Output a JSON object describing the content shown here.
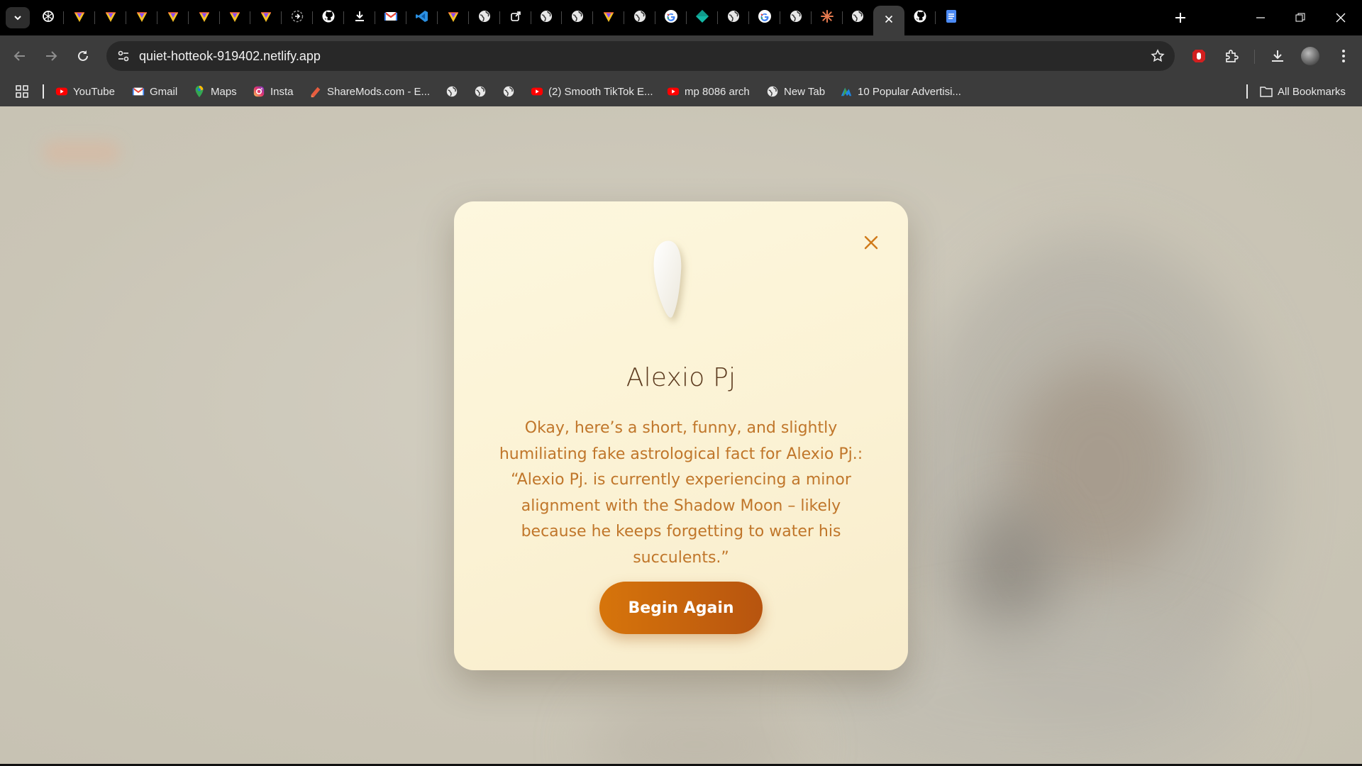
{
  "browser": {
    "address_bar": {
      "url": "quiet-hotteok-919402.netlify.app"
    },
    "tabs": [
      {
        "icon": "chatgpt-icon"
      },
      {
        "icon": "gemini-icon"
      },
      {
        "icon": "gemini-icon"
      },
      {
        "icon": "gemini-icon"
      },
      {
        "icon": "gemini-icon"
      },
      {
        "icon": "gemini-icon"
      },
      {
        "icon": "gemini-icon"
      },
      {
        "icon": "gemini-icon"
      },
      {
        "icon": "circle-arrow-icon"
      },
      {
        "icon": "github-icon"
      },
      {
        "icon": "download-icon"
      },
      {
        "icon": "gmail-icon"
      },
      {
        "icon": "vscode-icon"
      },
      {
        "icon": "gemini-icon"
      },
      {
        "icon": "globe-icon"
      },
      {
        "icon": "share-icon"
      },
      {
        "icon": "globe-icon"
      },
      {
        "icon": "globe-icon"
      },
      {
        "icon": "gemini-icon"
      },
      {
        "icon": "globe-icon"
      },
      {
        "icon": "google-icon"
      },
      {
        "icon": "diamond-icon"
      },
      {
        "icon": "globe-icon"
      },
      {
        "icon": "google-icon"
      },
      {
        "icon": "globe-icon"
      },
      {
        "icon": "claude-icon"
      },
      {
        "icon": "globe-icon"
      },
      {
        "icon": "close-icon",
        "active": true
      },
      {
        "icon": "github-icon"
      },
      {
        "icon": "docs-icon"
      }
    ],
    "bookmarks": [
      {
        "label": "YouTube",
        "icon": "youtube-icon"
      },
      {
        "label": "Gmail",
        "icon": "gmail-icon"
      },
      {
        "label": "Maps",
        "icon": "maps-icon"
      },
      {
        "label": "Insta",
        "icon": "instagram-icon"
      },
      {
        "label": "ShareMods.com - E...",
        "icon": "sharemods-icon"
      },
      {
        "label": "",
        "icon": "globe-icon"
      },
      {
        "label": "",
        "icon": "globe-icon"
      },
      {
        "label": "",
        "icon": "globe-icon"
      },
      {
        "label": "(2) Smooth TikTok E...",
        "icon": "youtube-icon"
      },
      {
        "label": "mp 8086 arch",
        "icon": "youtube-icon"
      },
      {
        "label": "New Tab",
        "icon": "globe-icon"
      },
      {
        "label": "10 Popular Advertisi...",
        "icon": "a-logo-icon"
      }
    ],
    "all_bookmarks_label": "All Bookmarks"
  },
  "modal": {
    "name": "Alexio Pj",
    "message": "Okay, here’s a short, funny, and slightly humiliating fake astrological fact for Alexio Pj.: “Alexio Pj. is currently experiencing a minor alignment with the Shadow Moon – likely because he keeps forgetting to water his succulents.”",
    "button_label": "Begin Again",
    "accent_color": "#c96510",
    "close_color": "#d07a1a"
  }
}
